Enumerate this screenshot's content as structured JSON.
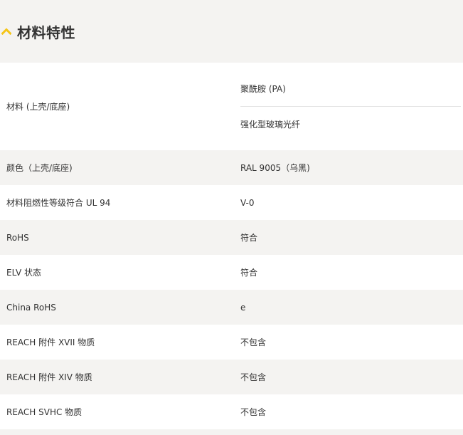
{
  "section": {
    "title": "材料特性",
    "toggle_icon": "chevron-up-icon",
    "accent_color": "#f5c518"
  },
  "rows": [
    {
      "label": "材料 (上壳/底座)",
      "values": [
        "聚酰胺 (PA)",
        "强化型玻璃光纤"
      ]
    },
    {
      "label": "颜色（上壳/底座)",
      "values": [
        "RAL 9005（乌黑)"
      ]
    },
    {
      "label": "材料阻燃性等级符合 UL 94",
      "values": [
        "V-0"
      ]
    },
    {
      "label": "RoHS",
      "values": [
        "符合"
      ]
    },
    {
      "label": "ELV 状态",
      "values": [
        "符合"
      ]
    },
    {
      "label": "China RoHS",
      "values": [
        "e"
      ]
    },
    {
      "label": "REACH 附件 XVII 物质",
      "values": [
        "不包含"
      ]
    },
    {
      "label": "REACH 附件 XIV 物质",
      "values": [
        "不包含"
      ]
    },
    {
      "label": "REACH SVHC 物质",
      "values": [
        "不包含"
      ]
    }
  ]
}
